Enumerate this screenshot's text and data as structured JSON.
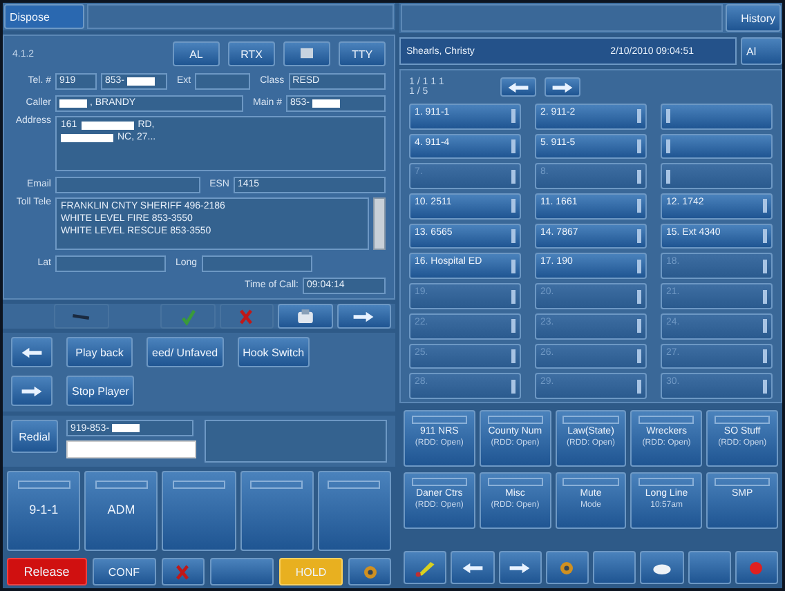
{
  "left": {
    "tab": "Dispose",
    "call_id": "4.1.2",
    "header_buttons": [
      {
        "kind": "text",
        "label": "AL"
      },
      {
        "kind": "text",
        "label": "RTX"
      },
      {
        "kind": "icon"
      },
      {
        "kind": "text",
        "label": "TTY"
      }
    ],
    "tel": {
      "label": "Tel. #",
      "area": "919",
      "number": "853-"
    },
    "ext": {
      "label": "Ext"
    },
    "class": {
      "label": "Class",
      "value": "RESD"
    },
    "caller": {
      "label": "Caller",
      "value": ", BRANDY"
    },
    "main": {
      "label": "Main #",
      "value": "853-"
    },
    "address": {
      "label": "Address",
      "line_1": "161",
      "line_1_end": "RD,",
      "line_2_end": "NC, 27..."
    },
    "email": {
      "label": "Email"
    },
    "esn": {
      "label": "ESN",
      "value": "1415"
    },
    "toll_tele": {
      "label": "Toll Tele",
      "lines": [
        "FRANKLIN CNTY SHERIFF  496-2186",
        "WHITE LEVEL FIRE  853-3550",
        "WHITE LEVEL RESCUE  853-3550"
      ]
    },
    "lat": {
      "label": "Lat"
    },
    "long": {
      "label": "Long"
    },
    "time_of_call": {
      "label": "Time of Call:",
      "value": "09:04:14"
    },
    "audio_buttons": [
      [
        "Play back",
        "eed/ Unfaved",
        "Hook Switch"
      ],
      [
        "Stop Player"
      ]
    ],
    "redial": {
      "label": "Redial",
      "number": "919-853-"
    },
    "lines": [
      {
        "kind": "line",
        "label": "9-1-1"
      },
      {
        "kind": "line",
        "label": "ADM"
      },
      {
        "kind": "line"
      },
      {
        "kind": "line"
      },
      {
        "kind": "line"
      }
    ],
    "bottom": {
      "release": "Release",
      "conf": "CONF",
      "hold": "HOLD"
    }
  },
  "right": {
    "history": "History",
    "agent": "Shearls, Christy",
    "datetime": "2/10/2010  09:04:51",
    "cut_button": "Al",
    "page_top": "1 / 1 1 1",
    "page": "1 / 5",
    "speed_dials": [
      {
        "label": "1. 911-1",
        "enabled": true
      },
      {
        "label": "2. 911-2",
        "enabled": true
      },
      {
        "enabled": true
      },
      {
        "label": "4. 911-4",
        "enabled": true
      },
      {
        "label": "5. 911-5",
        "enabled": true
      },
      {
        "enabled": true
      },
      {
        "label": "7.",
        "enabled": false
      },
      {
        "label": "8.",
        "enabled": false
      },
      {
        "enabled": false
      },
      {
        "label": "10. 2511",
        "enabled": true
      },
      {
        "label": "11. 1661",
        "enabled": true
      },
      {
        "label": "12. 1742",
        "enabled": true
      },
      {
        "label": "13. 6565",
        "enabled": true
      },
      {
        "label": "14. 7867",
        "enabled": true
      },
      {
        "label": "15. Ext 4340",
        "enabled": true
      },
      {
        "label": "16. Hospital ED",
        "enabled": true
      },
      {
        "label": "17. 190",
        "enabled": true
      },
      {
        "label": "18.",
        "enabled": false
      },
      {
        "label": "19.",
        "enabled": false
      },
      {
        "label": "20.",
        "enabled": false
      },
      {
        "label": "21.",
        "enabled": false
      },
      {
        "label": "22.",
        "enabled": false
      },
      {
        "label": "23.",
        "enabled": false
      },
      {
        "label": "24.",
        "enabled": false
      },
      {
        "label": "25.",
        "enabled": false
      },
      {
        "label": "26.",
        "enabled": false
      },
      {
        "label": "27.",
        "enabled": false
      },
      {
        "label": "28.",
        "enabled": false
      },
      {
        "label": "29.",
        "enabled": false
      },
      {
        "label": "30.",
        "enabled": false
      }
    ],
    "trunks": [
      {
        "name": "911 NRS",
        "status": "(RDD: Open)"
      },
      {
        "name": "County Num",
        "status": "(RDD: Open)"
      },
      {
        "name": "Law(State)",
        "status": "(RDD: Open)"
      },
      {
        "name": "Wreckers",
        "status": "(RDD: Open)"
      },
      {
        "name": "SO Stuff",
        "status": "(RDD: Open)"
      },
      {
        "name": "Daner Ctrs",
        "status": "(RDD: Open)"
      },
      {
        "name": "Misc",
        "status": "(RDD: Open)"
      },
      {
        "name": "Mute",
        "status": "Mode"
      },
      {
        "name": "Long Line",
        "status": "10:57am"
      },
      {
        "name": "SMP"
      }
    ]
  }
}
